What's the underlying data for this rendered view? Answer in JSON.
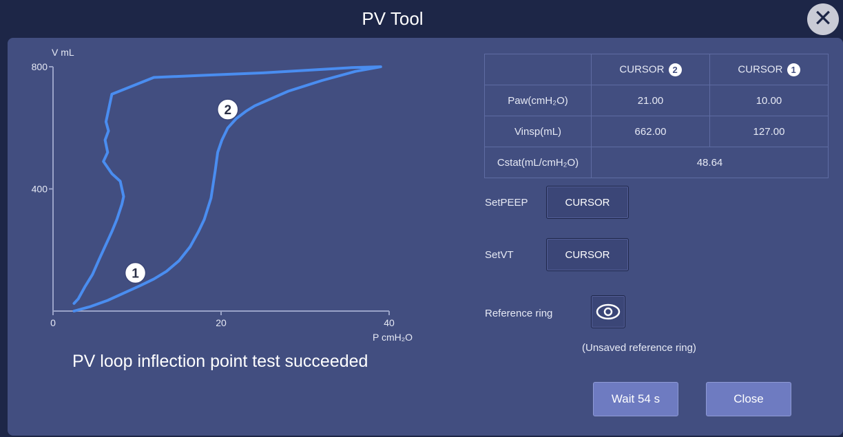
{
  "window": {
    "title": "PV Tool",
    "close_icon": "close-icon"
  },
  "chart_data": {
    "type": "line",
    "xlabel": "P cmH₂O",
    "ylabel": "V mL",
    "xlim": [
      0,
      40
    ],
    "ylim": [
      0,
      800
    ],
    "x_ticks": [
      "0",
      "20",
      "40"
    ],
    "y_ticks": [
      "400",
      "800"
    ],
    "series": [
      {
        "color": "#4a8df0",
        "points": [
          [
            2.5,
            0
          ],
          [
            4.5,
            15
          ],
          [
            6.5,
            35
          ],
          [
            8.5,
            60
          ],
          [
            10.5,
            85
          ],
          [
            12,
            105
          ],
          [
            13.5,
            130
          ],
          [
            15,
            165
          ],
          [
            16.3,
            210
          ],
          [
            17.3,
            260
          ],
          [
            18,
            300
          ],
          [
            18.8,
            370
          ],
          [
            19.3,
            460
          ],
          [
            19.6,
            520
          ],
          [
            20.1,
            560
          ],
          [
            20.8,
            600
          ],
          [
            21.8,
            630
          ],
          [
            23,
            655
          ],
          [
            24,
            672
          ],
          [
            25.5,
            690
          ],
          [
            28,
            720
          ],
          [
            32,
            755
          ],
          [
            36,
            785
          ],
          [
            39,
            800
          ],
          [
            35.5,
            797
          ],
          [
            25,
            780
          ],
          [
            18,
            772
          ],
          [
            12,
            765
          ],
          [
            7,
            710
          ],
          [
            6.3,
            620
          ],
          [
            6.6,
            590
          ],
          [
            6.2,
            560
          ],
          [
            6.5,
            520
          ],
          [
            6.0,
            490
          ],
          [
            7.0,
            450
          ],
          [
            8.0,
            425
          ],
          [
            8.4,
            375
          ],
          [
            8.2,
            350
          ],
          [
            7.6,
            300
          ],
          [
            7.0,
            260
          ],
          [
            6.5,
            230
          ],
          [
            5.5,
            170
          ],
          [
            4.7,
            120
          ],
          [
            3.8,
            80
          ],
          [
            3.0,
            40
          ],
          [
            2.5,
            25
          ]
        ]
      }
    ],
    "markers": [
      {
        "label": "1",
        "x": 9.8,
        "y": 125
      },
      {
        "label": "2",
        "x": 20.8,
        "y": 660
      }
    ]
  },
  "status": "PV loop inflection point test succeeded",
  "table": {
    "col2_header": "CURSOR",
    "col2_badge": "2",
    "col3_header": "CURSOR",
    "col3_badge": "1",
    "rows": [
      {
        "label": "Paw(cmH₂O)",
        "c2": "21.00",
        "c1": "10.00"
      },
      {
        "label": "Vinsp(mL)",
        "c2": "662.00",
        "c1": "127.00"
      }
    ],
    "cstat_label": "Cstat(mL/cmH₂O)",
    "cstat_value": "48.64"
  },
  "controls": {
    "setpeep_label": "SetPEEP",
    "setpeep_button": "CURSOR",
    "setvt_label": "SetVT",
    "setvt_button": "CURSOR",
    "reference_label": "Reference ring",
    "reference_icon": "eye-icon",
    "reference_note": "(Unsaved reference ring)"
  },
  "actions": {
    "wait_label": "Wait 54 s",
    "close_label": "Close"
  }
}
